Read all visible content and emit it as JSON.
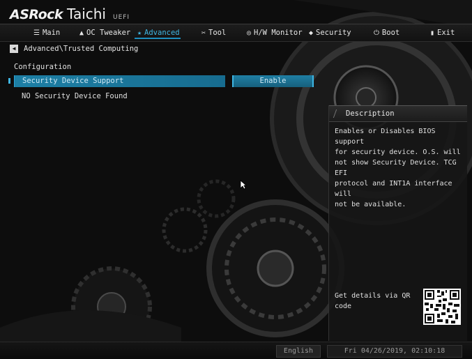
{
  "brand": {
    "logo": "ASRock",
    "model": "Taichi",
    "uefi": "UEFI"
  },
  "menu": {
    "items": [
      {
        "label": "Main",
        "icon": "list-icon"
      },
      {
        "label": "OC Tweaker",
        "icon": "rocket-icon"
      },
      {
        "label": "Advanced",
        "icon": "star-icon",
        "active": true
      },
      {
        "label": "Tool",
        "icon": "tools-icon"
      },
      {
        "label": "H/W Monitor",
        "icon": "monitor-icon"
      },
      {
        "label": "Security",
        "icon": "shield-icon"
      },
      {
        "label": "Boot",
        "icon": "power-icon"
      },
      {
        "label": "Exit",
        "icon": "exit-icon"
      }
    ],
    "active_color": "#3fb6e3"
  },
  "breadcrumb": {
    "path": "Advanced\\Trusted Computing"
  },
  "main": {
    "section_title": "Configuration",
    "selected_option": {
      "label": "Security Device Support",
      "value": "Enable"
    },
    "info": "NO Security Device Found"
  },
  "description": {
    "title": "Description",
    "text": "Enables or Disables BIOS support\nfor security device. O.S. will\nnot show Security Device. TCG EFI\nprotocol and INT1A interface will\nnot be available.",
    "qr_label": "Get details via QR\ncode"
  },
  "footer": {
    "language": "English",
    "datetime": "Fri 04/26/2019, 02:10:18"
  },
  "colors": {
    "highlight": "#1d7fa5",
    "accent": "#3fb6e3",
    "background": "#0c0c0c"
  }
}
